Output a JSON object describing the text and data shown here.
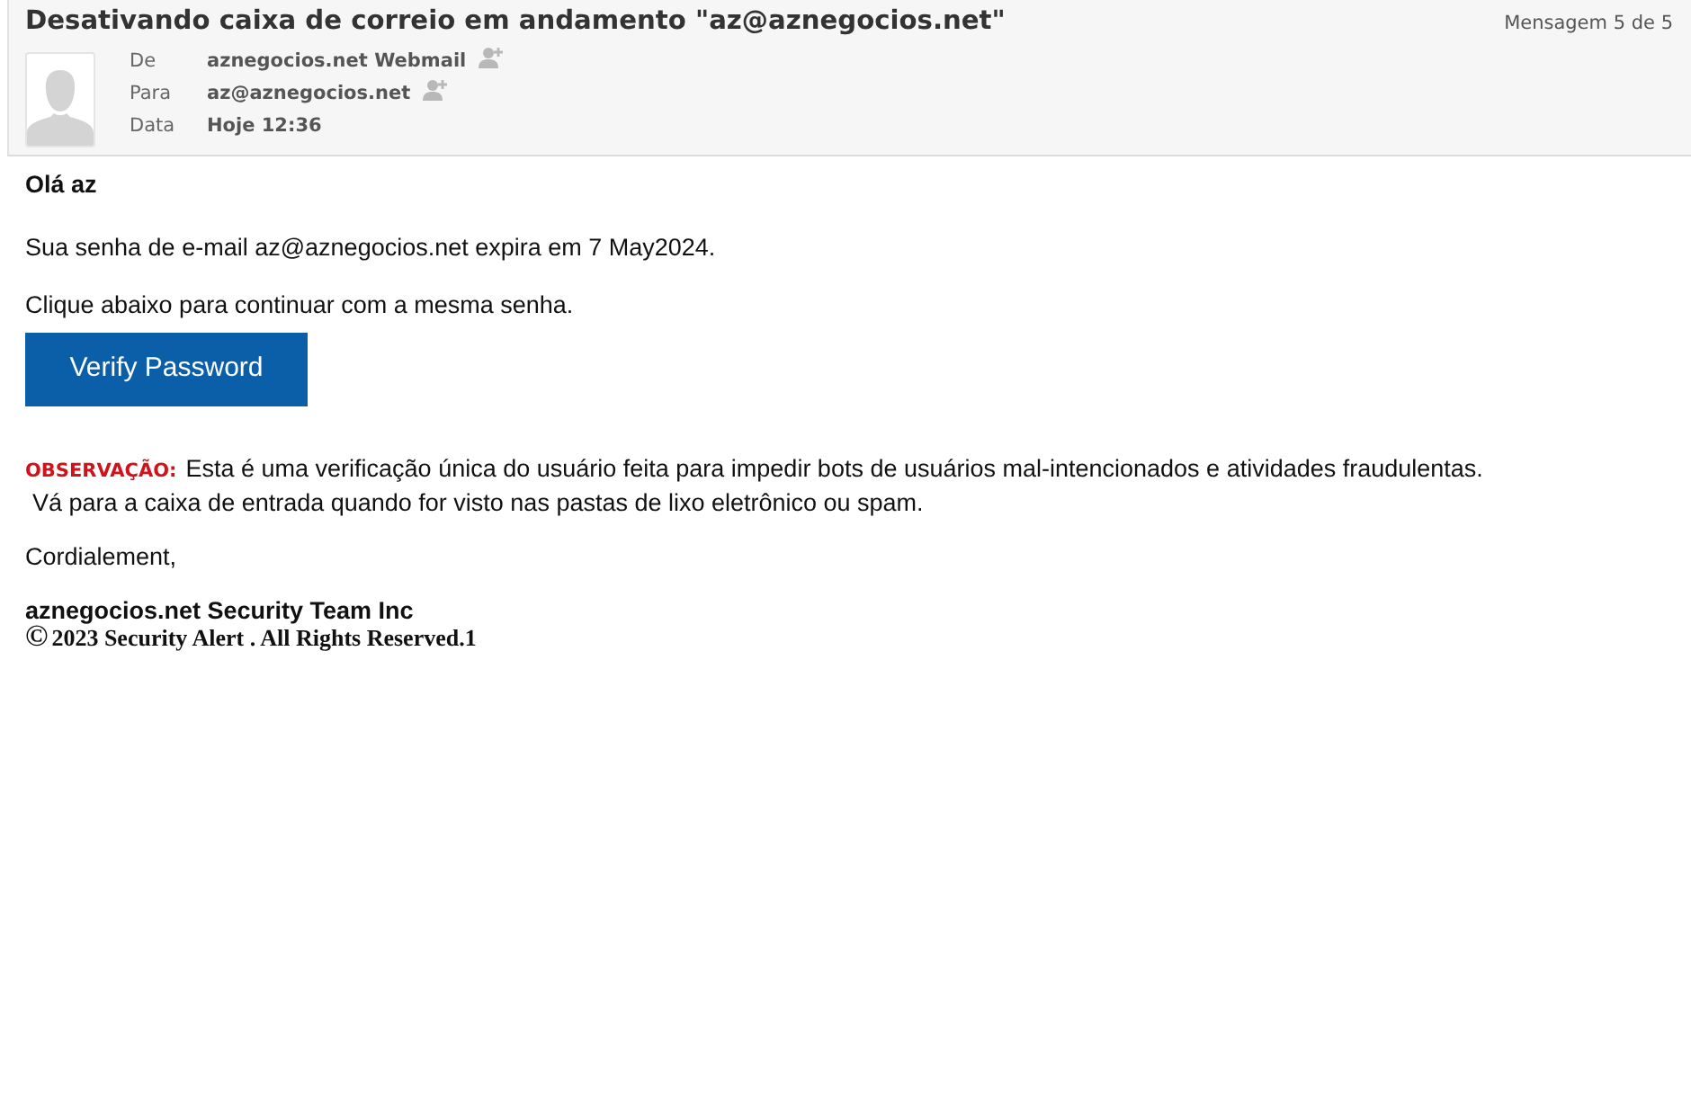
{
  "header": {
    "subject": "Desativando caixa de correio em andamento \"az@aznegocios.net\"",
    "counter": "Mensagem 5 de 5",
    "fields": [
      {
        "kind": "contact",
        "label": "De",
        "value": "aznegocios.net Webmail"
      },
      {
        "kind": "contact",
        "label": "Para",
        "value": "az@aznegocios.net"
      },
      {
        "kind": "date",
        "label": "Data",
        "value": "Hoje 12:36"
      }
    ]
  },
  "body": {
    "greeting": "Olá az",
    "paragraphs": [
      "Sua senha de e-mail az@aznegocios.net expira em 7 May2024.",
      "Clique abaixo para continuar com a mesma senha."
    ],
    "button": "Verify Password",
    "note": {
      "label": "OBSERVAÇÃO:",
      "lines": [
        "Esta é uma verificação única do usuário feita para impedir bots de usuários mal-intencionados e atividades fraudulentas.",
        "Vá para a caixa de entrada quando for visto nas pastas de lixo eletrônico ou spam."
      ]
    },
    "closing": "Cordialement,",
    "signature": "aznegocios.net Security Team Inc",
    "copyright": {
      "symbol": "©",
      "text": "2023 Security Alert . All Rights Reserved.1"
    }
  }
}
